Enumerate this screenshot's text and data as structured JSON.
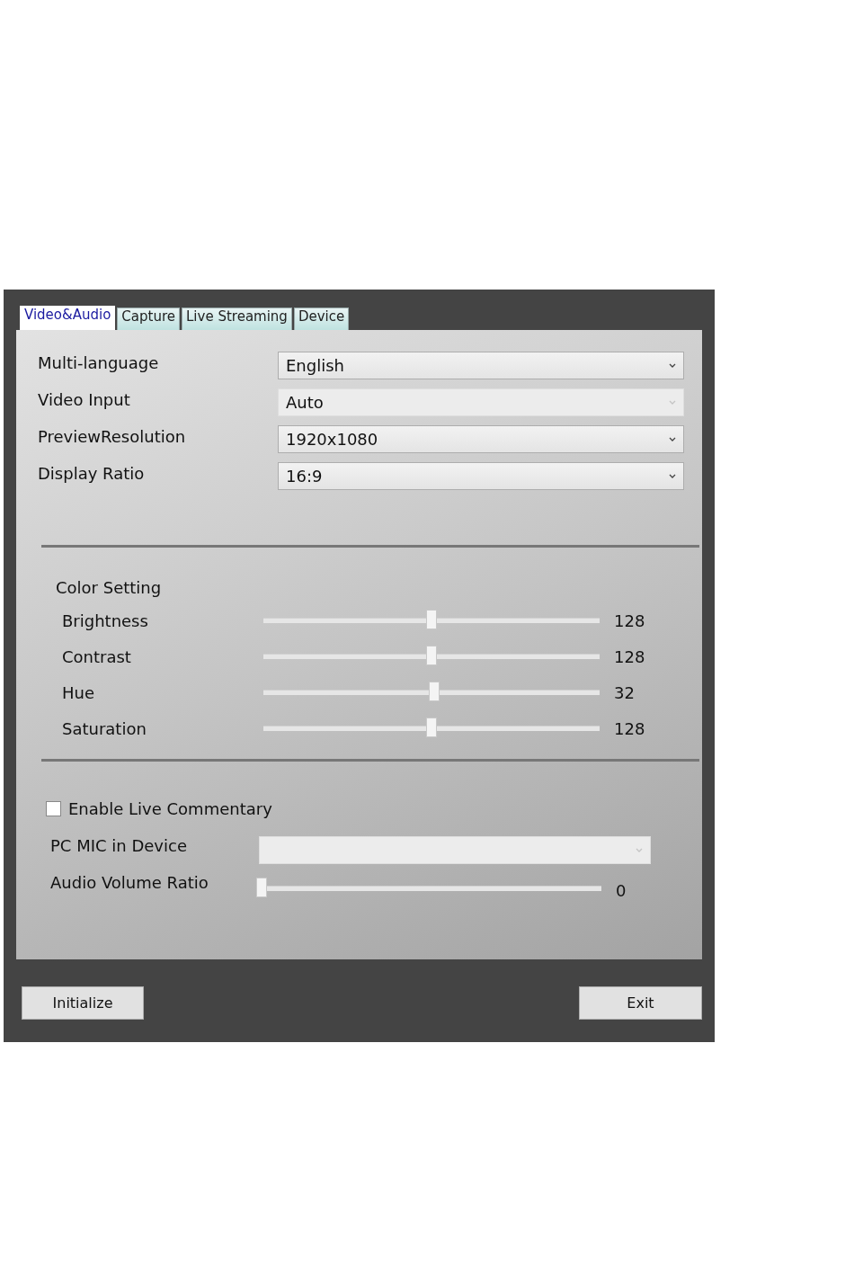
{
  "tabs": [
    {
      "label": "Video&Audio",
      "selected": true
    },
    {
      "label": "Capture",
      "selected": false
    },
    {
      "label": "Live Streaming",
      "selected": false
    },
    {
      "label": "Device",
      "selected": false
    }
  ],
  "general_settings": [
    {
      "label": "Multi-language",
      "value": "English",
      "disabled": false
    },
    {
      "label": "Video Input",
      "value": "Auto",
      "disabled": true
    },
    {
      "label": "PreviewResolution",
      "value": "1920x1080",
      "disabled": false
    },
    {
      "label": "Display Ratio",
      "value": "16:9",
      "disabled": false
    }
  ],
  "color_setting": {
    "title": "Color Setting",
    "sliders": [
      {
        "label": "Brightness",
        "level": 0.5,
        "reading": "128"
      },
      {
        "label": "Contrast",
        "level": 0.5,
        "reading": "128"
      },
      {
        "label": "Hue",
        "level": 0.508,
        "reading": "32"
      },
      {
        "label": "Saturation",
        "level": 0.5,
        "reading": "128"
      }
    ]
  },
  "live_commentary": {
    "label": "Enable Live Commentary",
    "checked": false
  },
  "mic_device": {
    "label": "PC MIC in Device",
    "disabled": true
  },
  "audio_volume": {
    "label": "Audio Volume Ratio",
    "level": 0,
    "reading": "0"
  },
  "buttons": [
    {
      "label": "Initialize"
    },
    {
      "label": "Exit"
    }
  ]
}
